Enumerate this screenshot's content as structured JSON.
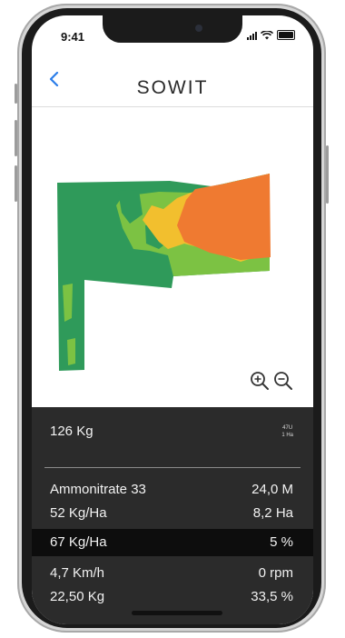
{
  "status_bar": {
    "time": "9:41"
  },
  "nav": {
    "logo": "SOWIT"
  },
  "map": {
    "zone_colors": {
      "dark_green": "#2f9a5a",
      "green": "#7cc243",
      "yellow": "#f2bf2e",
      "orange": "#ef7a31"
    }
  },
  "summary": {
    "total": "126 Kg",
    "unit_line1": "47U",
    "unit_line2": "1 Ha"
  },
  "details": {
    "product": "Ammonitrate 33",
    "width": "24,0 M",
    "dose": "52 Kg/Ha",
    "area": "8,2 Ha",
    "current_dose": "67 Kg/Ha",
    "current_percent": "5 %",
    "speed": "4,7 Km/h",
    "rotation": "0 rpm",
    "spread_weight": "22,50 Kg",
    "progress": "33,5 %"
  }
}
